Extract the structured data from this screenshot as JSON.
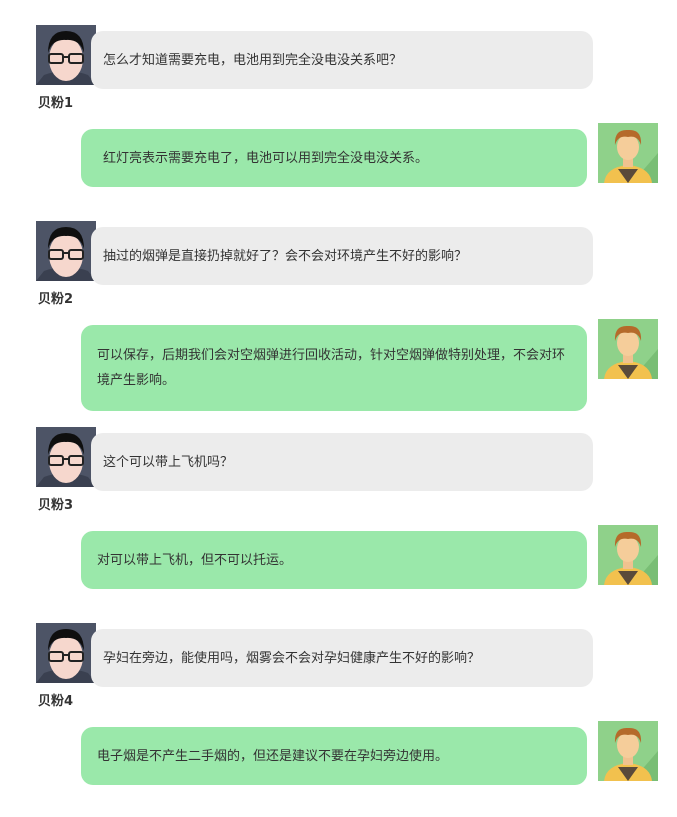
{
  "conversation": [
    {
      "user": "贝粉1",
      "question": "怎么才知道需要充电，电池用到完全没电没关系吧？",
      "answer": "红灯亮表示需要充电了，电池可以用到完全没电没关系。"
    },
    {
      "user": "贝粉2",
      "question": "抽过的烟弹是直接扔掉就好了？会不会对环境产生不好的影响？",
      "answer": "可以保存，后期我们会对空烟弹进行回收活动，针对空烟弹做特别处理，不会对环境产生影响。"
    },
    {
      "user": "贝粉3",
      "question": "这个可以带上飞机吗？",
      "answer": "对可以带上飞机，但不可以托运。"
    },
    {
      "user": "贝粉4",
      "question": "孕妇在旁边，能使用吗，烟雾会不会对孕妇健康产生不好的影响？",
      "answer": "电子烟是不产生二手烟的，但还是建议不要在孕妇旁边使用。"
    }
  ],
  "icons": {
    "user_avatar": "user-avatar-glasses-icon",
    "staff_avatar": "staff-avatar-icon"
  },
  "colors": {
    "user_bubble": "#ececec",
    "staff_bubble": "#9ae8aa"
  }
}
